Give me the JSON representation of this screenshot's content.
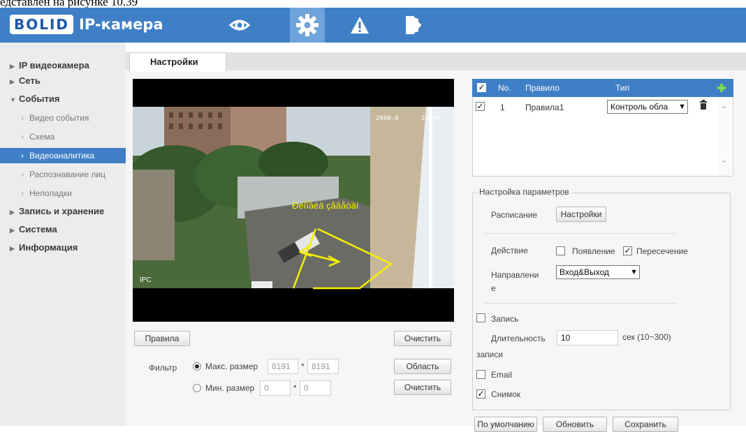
{
  "doc_caption": "едставлен на рисунке 10.39",
  "header": {
    "logo_text": "BOLID",
    "product": "IP-камера",
    "nav": [
      "eye-icon",
      "gear-icon",
      "warning-icon",
      "exit-icon"
    ],
    "accent": "#3f7fc6"
  },
  "sidebar": {
    "items": [
      {
        "label": "IP видеокамера",
        "type": "top",
        "expanded": false
      },
      {
        "label": "Сеть",
        "type": "top",
        "expanded": false
      },
      {
        "label": "События",
        "type": "top",
        "expanded": true
      },
      {
        "label": "Видео события",
        "type": "sub"
      },
      {
        "label": "Схема",
        "type": "sub"
      },
      {
        "label": "Видеоаналитика",
        "type": "sub",
        "active": true
      },
      {
        "label": "Распознавание лиц",
        "type": "sub"
      },
      {
        "label": "Неполадки",
        "type": "sub"
      },
      {
        "label": "Запись и хранение",
        "type": "top",
        "expanded": false
      },
      {
        "label": "Система",
        "type": "top",
        "expanded": false
      },
      {
        "label": "Информация",
        "type": "top",
        "expanded": false
      }
    ]
  },
  "tab": {
    "label": "Настройки"
  },
  "video": {
    "timestamp": "2000-0      23:00",
    "channel": "IPC",
    "overlay_label": "Ðèíïàéä çåâåòàí"
  },
  "left_controls": {
    "rules_button": "Правила",
    "clear_button_1": "Очистить",
    "filter_label": "Фильтр",
    "max_label": "Макс. размер",
    "max_w": "8191",
    "max_h": "8191",
    "min_label": "Мин. размер",
    "min_w": "0",
    "min_h": "0",
    "times": "*",
    "area_button": "Область",
    "clear_button_2": "Очистить"
  },
  "rules_table": {
    "headers": {
      "no": "No.",
      "rule": "Правило",
      "type": "Тип"
    },
    "rows": [
      {
        "no": "1",
        "rule": "Правила1",
        "type": "Контроль обла",
        "checked": true
      }
    ]
  },
  "params": {
    "legend": "Настройка параметров",
    "schedule_label": "Расписание",
    "schedule_button": "Настройки",
    "action_label": "Действие",
    "appearance_label": "Появление",
    "appearance_checked": false,
    "crossing_label": "Пересечение",
    "crossing_checked": true,
    "direction_label_1": "Направлени",
    "direction_label_2": "е",
    "direction_value": "Вход&Выход",
    "record_label": "Запись",
    "record_checked": false,
    "duration_label_1": "Длительность",
    "duration_label_2": "записи",
    "duration_value": "10",
    "duration_hint": "сек (10~300)",
    "email_label": "Email",
    "email_checked": false,
    "snapshot_label": "Снимок",
    "snapshot_checked": true
  },
  "footer": {
    "default_button": "По умолчанию",
    "refresh_button": "Обновить",
    "save_button": "Сохранить"
  }
}
